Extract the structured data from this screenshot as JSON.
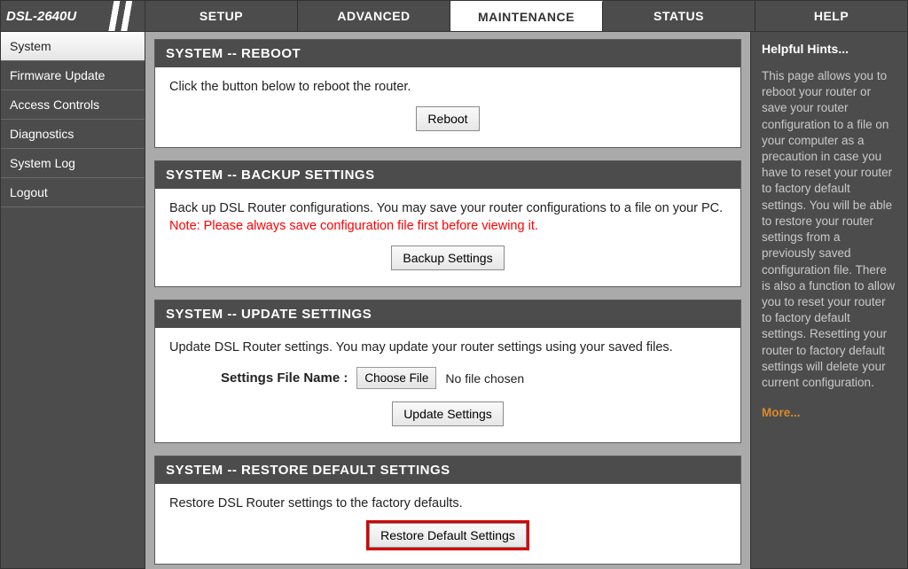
{
  "device_model": "DSL-2640U",
  "topnav": {
    "tabs": [
      "SETUP",
      "ADVANCED",
      "MAINTENANCE",
      "STATUS",
      "HELP"
    ],
    "active_index": 2
  },
  "sidebar": {
    "items": [
      "System",
      "Firmware Update",
      "Access Controls",
      "Diagnostics",
      "System Log",
      "Logout"
    ],
    "active_index": 0
  },
  "panels": {
    "reboot": {
      "title": "SYSTEM -- REBOOT",
      "text": "Click the button below to reboot the router.",
      "button": "Reboot"
    },
    "backup": {
      "title": "SYSTEM -- BACKUP SETTINGS",
      "text": "Back up DSL Router configurations. You may save your router configurations to a file on your PC.",
      "note": "Note: Please always save configuration file first before viewing it.",
      "button": "Backup Settings"
    },
    "update": {
      "title": "SYSTEM -- UPDATE SETTINGS",
      "text": "Update DSL Router settings. You may update your router settings using your saved files.",
      "file_label": "Settings File Name :",
      "choose_label": "Choose File",
      "file_status": "No file chosen",
      "button": "Update Settings"
    },
    "restore": {
      "title": "SYSTEM -- RESTORE DEFAULT SETTINGS",
      "text": "Restore DSL Router settings to the factory defaults.",
      "button": "Restore Default Settings"
    }
  },
  "help": {
    "title": "Helpful Hints...",
    "body": "This page allows you to reboot your router or save your router configuration to a file on your computer as a precaution in case you have to reset your router to factory default settings. You will be able to restore your router settings from a previously saved configuration file. There is also a function to allow you to reset your router to factory default settings. Resetting your router to factory default settings will delete your current configuration.",
    "more": "More..."
  }
}
